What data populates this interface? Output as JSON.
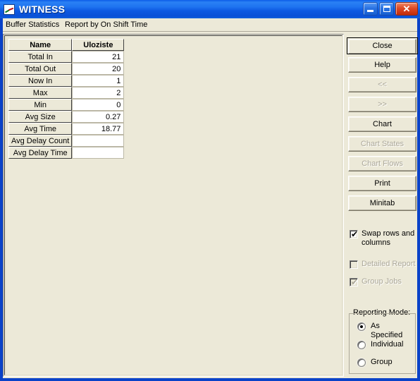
{
  "window": {
    "title": "WITNESS",
    "app_icon": "chart-window-icon",
    "titlebar_buttons": {
      "minimize": "minimize-icon",
      "maximize": "maximize-icon",
      "close": "close-icon",
      "close_glyph": "✕"
    }
  },
  "report_header": {
    "statistics_label": "Buffer Statistics",
    "mode_label": "Report by On Shift Time"
  },
  "table": {
    "columns": [
      "Name",
      "Uloziste"
    ],
    "rows": [
      {
        "name": "Total In",
        "value": "21"
      },
      {
        "name": "Total Out",
        "value": "20"
      },
      {
        "name": "Now In",
        "value": "1"
      },
      {
        "name": "Max",
        "value": "2"
      },
      {
        "name": "Min",
        "value": "0"
      },
      {
        "name": "Avg Size",
        "value": "0.27"
      },
      {
        "name": "Avg Time",
        "value": "18.77"
      },
      {
        "name": "Avg Delay Count",
        "value": ""
      },
      {
        "name": "Avg Delay Time",
        "value": ""
      }
    ]
  },
  "buttons": [
    {
      "label": "Close",
      "enabled": true,
      "default": true
    },
    {
      "label": "Help",
      "enabled": true,
      "default": false
    },
    {
      "label": "<<",
      "enabled": false,
      "default": false
    },
    {
      "label": ">>",
      "enabled": false,
      "default": false
    },
    {
      "label": "Chart",
      "enabled": true,
      "default": false
    },
    {
      "label": "Chart States",
      "enabled": false,
      "default": false
    },
    {
      "label": "Chart Flows",
      "enabled": false,
      "default": false
    },
    {
      "label": "Print",
      "enabled": true,
      "default": false
    },
    {
      "label": "Minitab",
      "enabled": true,
      "default": false
    }
  ],
  "checkboxes": [
    {
      "label": "Swap rows and columns",
      "checked": true,
      "enabled": true
    },
    {
      "label": "Detailed Report",
      "checked": false,
      "enabled": false
    },
    {
      "label": "Group Jobs",
      "checked": true,
      "enabled": false
    }
  ],
  "checkbox_tick": "✔",
  "reporting_mode": {
    "legend": "Reporting Mode:",
    "options": [
      {
        "label": "As Specified",
        "selected": true
      },
      {
        "label": "Individual",
        "selected": false
      },
      {
        "label": "Group",
        "selected": false
      }
    ]
  },
  "colors": {
    "window_frame": "#0A42C8",
    "titlebar_blue": "#1E73F0",
    "face": "#ECE9D8",
    "field": "#FFFFFF",
    "disabled_text": "#ACA899",
    "close_red": "#DE4A26"
  }
}
